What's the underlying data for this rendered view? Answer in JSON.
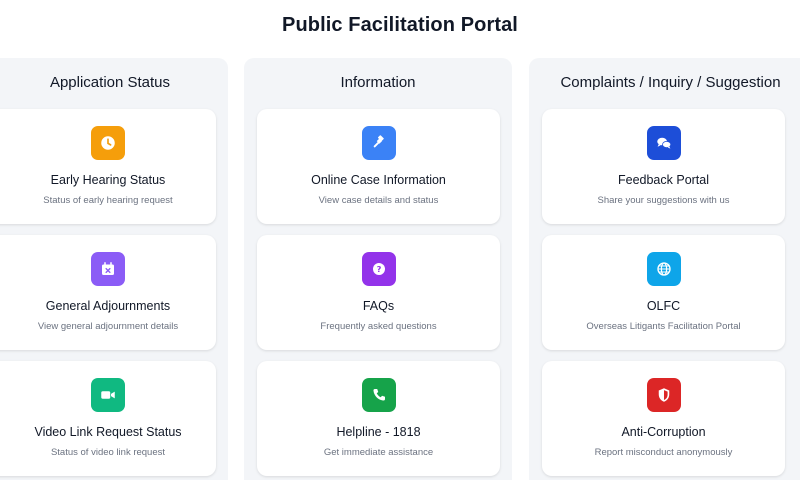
{
  "page": {
    "title": "Public Facilitation Portal"
  },
  "columns": [
    {
      "title": "Application Status",
      "cards": [
        {
          "title": "Early Hearing Status",
          "desc": "Status of early hearing request",
          "icon": "clock-icon",
          "color": "#f59e0b"
        },
        {
          "title": "General Adjournments",
          "desc": "View general adjournment details",
          "icon": "calendar-x-icon",
          "color": "#8b5cf6"
        },
        {
          "title": "Video Link Request Status",
          "desc": "Status of video link request",
          "icon": "video-icon",
          "color": "#10b981"
        }
      ]
    },
    {
      "title": "Information",
      "cards": [
        {
          "title": "Online Case Information",
          "desc": "View case details and status",
          "icon": "gavel-icon",
          "color": "#3b82f6"
        },
        {
          "title": "FAQs",
          "desc": "Frequently asked questions",
          "icon": "question-icon",
          "color": "#9333ea"
        },
        {
          "title": "Helpline - 1818",
          "desc": "Get immediate assistance",
          "icon": "phone-icon",
          "color": "#16a34a"
        }
      ]
    },
    {
      "title": "Complaints / Inquiry / Suggestion",
      "cards": [
        {
          "title": "Feedback Portal",
          "desc": "Share your suggestions with us",
          "icon": "chat-bubbles-icon",
          "color": "#1d4ed8"
        },
        {
          "title": "OLFC",
          "desc": "Overseas Litigants Facilitation Portal",
          "icon": "globe-icon",
          "color": "#0ea5e9"
        },
        {
          "title": "Anti-Corruption",
          "desc": "Report misconduct anonymously",
          "icon": "shield-icon",
          "color": "#dc2626"
        }
      ]
    }
  ]
}
